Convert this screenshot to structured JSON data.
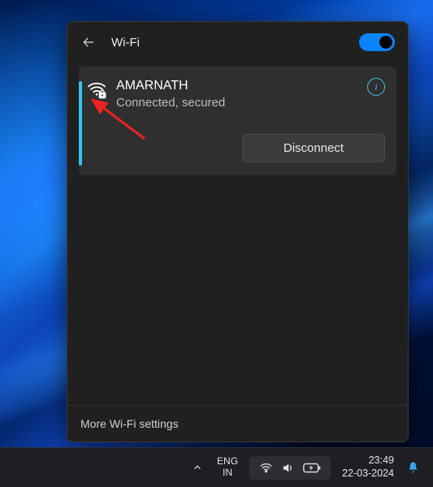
{
  "header": {
    "title": "Wi-Fi",
    "toggle_on": true
  },
  "network": {
    "name": "AMARNATH",
    "status": "Connected, secured",
    "info_glyph": "i",
    "disconnect_label": "Disconnect"
  },
  "footer": {
    "more_link": "More Wi-Fi settings"
  },
  "taskbar": {
    "lang_line1": "ENG",
    "lang_line2": "IN",
    "time": "23:49",
    "date": "22-03-2024"
  }
}
